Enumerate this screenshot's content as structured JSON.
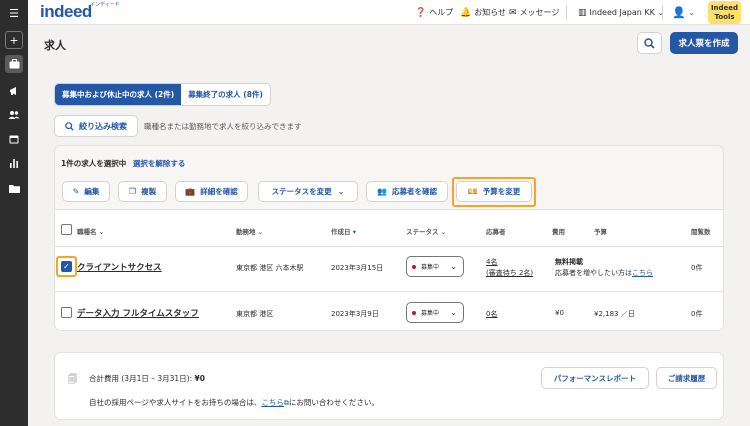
{
  "header": {
    "logo": "indeed",
    "logo_sub": "インディード",
    "help": "ヘルプ",
    "notifications": "お知らせ",
    "messages": "メッセージ",
    "company": "Indeed Japan KK",
    "tools_line1": "Indeed",
    "tools_line2": "Tools"
  },
  "page": {
    "title": "求人",
    "create_button": "求人票を作成"
  },
  "tabs": [
    {
      "label": "募集中および休止中の求人 (2件)",
      "active": true
    },
    {
      "label": "募集終了の求人 (8件)",
      "active": false
    }
  ],
  "filter": {
    "button": "絞り込み検索",
    "hint": "職種名または勤務地で求人を絞り込みできます"
  },
  "selection": {
    "text": "1件の求人を選択中",
    "clear": "選択を解除する",
    "actions": {
      "edit": "編集",
      "copy": "複製",
      "details": "詳細を確認",
      "status": "ステータスを変更",
      "applicants": "応募者を確認",
      "budget": "予算を変更"
    }
  },
  "table": {
    "columns": {
      "title": "職種名",
      "location": "勤務地",
      "created": "作成日",
      "status": "ステータス",
      "applicants": "応募者",
      "cost": "費用",
      "budget": "予算",
      "views": "閲覧数"
    },
    "rows": [
      {
        "checked": true,
        "title": "クライアントサクセス",
        "location": "東京都 港区 六本木駅",
        "created": "2023年3月15日",
        "status": "募集中",
        "applicants": "4名",
        "applicants_pending": "(審査待ち 2名)",
        "cost": "無料掲載",
        "budget_note": "応募者を増やしたい方は",
        "budget_link": "こちら",
        "views": "0件"
      },
      {
        "checked": false,
        "title": "データ入力 フルタイムスタッフ",
        "location": "東京都 港区",
        "created": "2023年3月9日",
        "status": "募集中",
        "applicants": "0名",
        "cost": "¥0",
        "budget": "¥2,183 ／日",
        "views": "0件"
      }
    ]
  },
  "billing": {
    "total_label": "合計費用 (3月1日 – 3月31日):",
    "total_value": "¥0",
    "note_before": "自社の採用ページや求人サイトをお持ちの場合は、",
    "note_link": "こちら",
    "note_after": "にお問い合わせください。",
    "perf_report": "パフォーマンスレポート",
    "billing_history": "ご請求履歴"
  },
  "colors": {
    "brand_blue": "#2557a7",
    "highlight": "#f6a623",
    "tools_yellow": "#ffe169"
  }
}
